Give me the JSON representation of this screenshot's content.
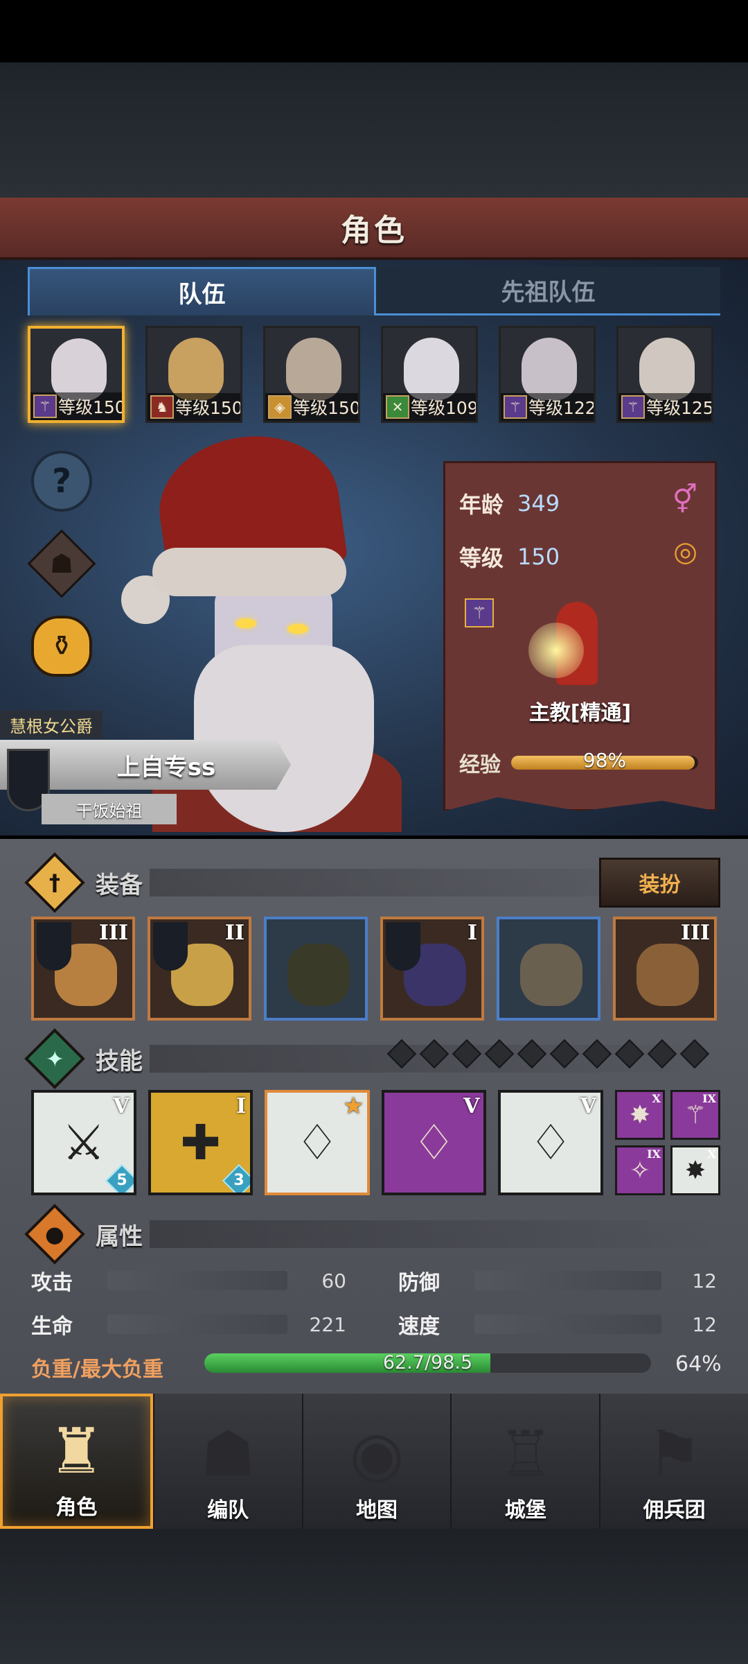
{
  "header": {
    "title": "角色"
  },
  "tabs": [
    {
      "label": "队伍"
    },
    {
      "label": "先祖队伍"
    }
  ],
  "roster": [
    {
      "level": "等级150",
      "class_icon": "staff-icon"
    },
    {
      "level": "等级150",
      "class_icon": "horse-icon"
    },
    {
      "level": "等级150",
      "class_icon": "shield-icon"
    },
    {
      "level": "等级109",
      "class_icon": "swords-icon"
    },
    {
      "level": "等级122",
      "class_icon": "staff-icon"
    },
    {
      "level": "等级125",
      "class_icon": "staff-icon"
    }
  ],
  "character": {
    "title": "慧根女公爵",
    "name": "上自专ss",
    "subtitle": "干饭始祖",
    "age_label": "年龄",
    "age": "349",
    "level_label": "等级",
    "level": "150",
    "class_name": "主教[精通]",
    "exp_label": "经验",
    "exp_text": "98%",
    "exp_progress": 0.98
  },
  "equipment": {
    "title": "装备",
    "dress_button": "装扮",
    "items": [
      {
        "tier": "III",
        "border": "orange"
      },
      {
        "tier": "II",
        "border": "orange"
      },
      {
        "tier": "",
        "border": "blue"
      },
      {
        "tier": "I",
        "border": "orange"
      },
      {
        "tier": "",
        "border": "blue"
      },
      {
        "tier": "III",
        "border": "orange"
      }
    ]
  },
  "skills": {
    "title": "技能",
    "items": [
      {
        "tier": "V",
        "count": "5"
      },
      {
        "tier": "I",
        "count": "3"
      },
      {
        "tier": "",
        "count": ""
      },
      {
        "tier": "V",
        "count": ""
      },
      {
        "tier": "V",
        "count": ""
      }
    ],
    "small": [
      {
        "tier": "X"
      },
      {
        "tier": "IX"
      },
      {
        "tier": "IX"
      },
      {
        "tier": "X"
      }
    ]
  },
  "attributes": {
    "title": "属性",
    "attack_label": "攻击",
    "attack": "60",
    "defense_label": "防御",
    "defense": "12",
    "hp_label": "生命",
    "hp": "221",
    "speed_label": "速度",
    "speed": "12",
    "load_label": "负重/最大负重",
    "load_text": "62.7/98.5",
    "load_progress": 0.64,
    "load_pct": "64%"
  },
  "nav": [
    {
      "label": "角色",
      "icon": "knight-icon"
    },
    {
      "label": "编队",
      "icon": "helmet-icon"
    },
    {
      "label": "地图",
      "icon": "compass-icon"
    },
    {
      "label": "城堡",
      "icon": "castle-icon"
    },
    {
      "label": "佣兵团",
      "icon": "banner-icon"
    }
  ],
  "colors": {
    "accent": "#f0a030",
    "tab_border": "#4b8fd6",
    "title_bar": "#6a302a"
  }
}
